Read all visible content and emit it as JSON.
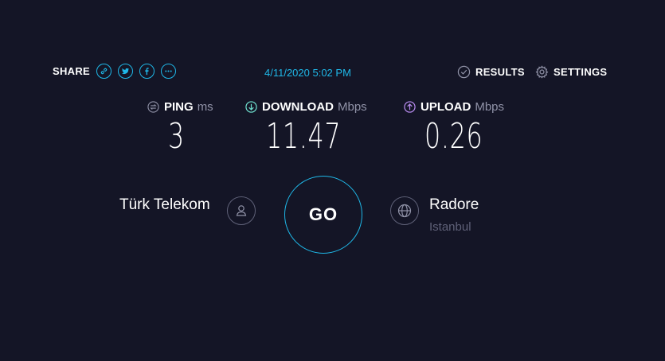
{
  "header": {
    "share_label": "SHARE",
    "share_icons": [
      "link-icon",
      "twitter-icon",
      "facebook-icon",
      "more-icon"
    ],
    "datetime": "4/11/2020 5:02 PM",
    "results_label": "RESULTS",
    "settings_label": "SETTINGS"
  },
  "metrics": {
    "ping": {
      "label": "PING",
      "unit": "ms",
      "value": "3"
    },
    "download": {
      "label": "DOWNLOAD",
      "unit": "Mbps",
      "value": "11.47"
    },
    "upload": {
      "label": "UPLOAD",
      "unit": "Mbps",
      "value": "0.26"
    }
  },
  "provider": {
    "name": "Türk Telekom"
  },
  "server": {
    "name": "Radore",
    "location": "Istanbul"
  },
  "go_label": "GO",
  "colors": {
    "background": "#141526",
    "accent": "#1fb8e8",
    "download": "#6fe0cf",
    "upload": "#b98cf0",
    "muted": "#9193a8"
  }
}
